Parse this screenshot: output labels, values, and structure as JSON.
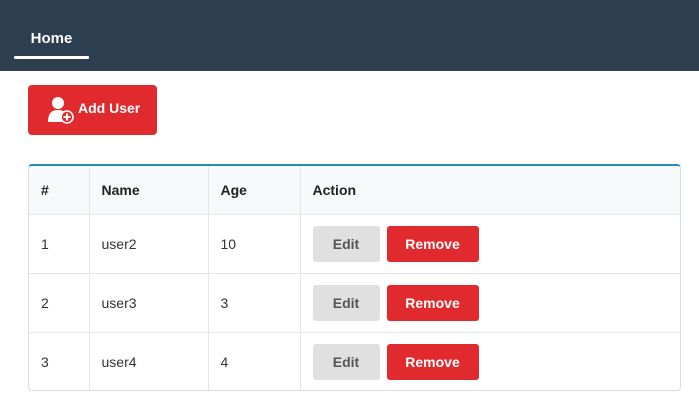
{
  "nav": {
    "items": [
      {
        "label": "Home",
        "active": true
      }
    ],
    "bg_color": "#2c3e50"
  },
  "toolbar": {
    "add_label": "Add User",
    "add_icon": "add-user-icon",
    "accent": "#e02a2e"
  },
  "table": {
    "headers": [
      "#",
      "Name",
      "Age",
      "Action"
    ],
    "rows": [
      {
        "num": "1",
        "name": "user2",
        "age": "10"
      },
      {
        "num": "2",
        "name": "user3",
        "age": "3"
      },
      {
        "num": "3",
        "name": "user4",
        "age": "4"
      }
    ],
    "edit_label": "Edit",
    "remove_label": "Remove",
    "header_border_color": "#2e86c1"
  }
}
